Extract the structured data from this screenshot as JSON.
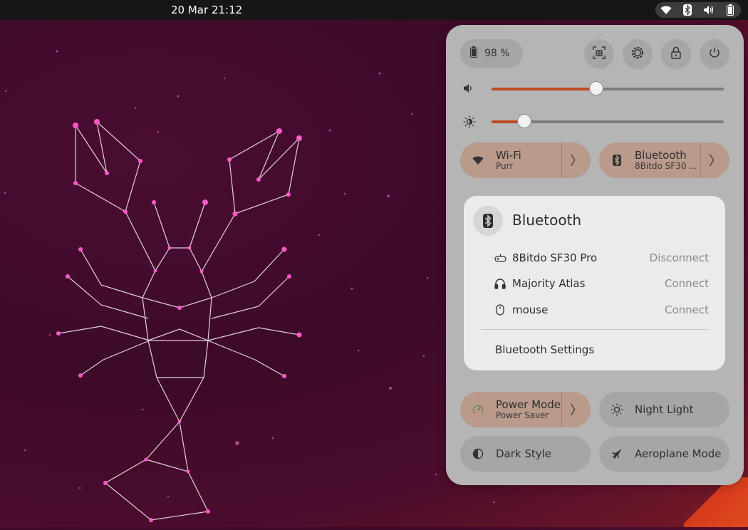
{
  "topbar": {
    "clock": "20 Mar  21:12",
    "tray_icons": [
      "wifi-icon",
      "bluetooth-icon",
      "volume-icon",
      "battery-icon"
    ]
  },
  "quick_settings": {
    "battery": {
      "label": "98 %",
      "icon": "battery-icon"
    },
    "actions": [
      "screenshot-icon",
      "settings-icon",
      "lock-icon",
      "power-icon"
    ],
    "volume": {
      "icon": "speaker-icon",
      "level": 0.45
    },
    "brightness": {
      "icon": "brightness-icon",
      "level": 0.14
    },
    "toggles": {
      "wifi": {
        "title": "Wi-Fi",
        "subtitle": "Purr",
        "icon": "wifi-icon",
        "arrow": "〉",
        "active": true
      },
      "bluetooth": {
        "title": "Bluetooth",
        "subtitle": "8Bitdo SF30 ...",
        "icon": "bluetooth-icon",
        "arrow": "〉",
        "active": true
      },
      "power_mode": {
        "title": "Power Mode",
        "subtitle": "Power Saver",
        "icon": "power-mode-icon",
        "arrow": "〉",
        "active": true
      },
      "night_light": {
        "title": "Night Light",
        "icon": "night-light-icon",
        "active": false
      },
      "dark_style": {
        "title": "Dark Style",
        "icon": "dark-style-icon",
        "active": false
      },
      "aeroplane_mode": {
        "title": "Aeroplane Mode",
        "icon": "aeroplane-icon",
        "active": false
      }
    },
    "bluetooth_menu": {
      "title": "Bluetooth",
      "devices": [
        {
          "name": "8Bitdo SF30 Pro",
          "action": "Disconnect",
          "icon": "gamepad-icon"
        },
        {
          "name": "Majority Atlas",
          "action": "Connect",
          "icon": "headphones-icon"
        },
        {
          "name": "mouse",
          "action": "Connect",
          "icon": "mouse-icon"
        }
      ],
      "settings_label": "Bluetooth Settings"
    }
  },
  "colors": {
    "accent": "#c0481f",
    "panel": "#b5b5b5",
    "active_toggle": "#b99a8b",
    "menu": "#ebebeb"
  }
}
